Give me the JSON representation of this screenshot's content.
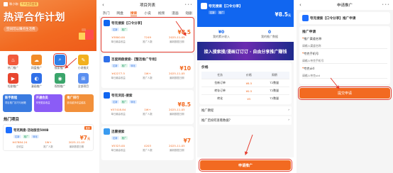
{
  "p1": {
    "brand": "咪小咖",
    "badge": "个人主页会员",
    "title": "热评合作计划",
    "subtitle": "空间可以赚点生活费",
    "icons": [
      {
        "label": "热门推广",
        "color": "#f25a3c",
        "g": "♨"
      },
      {
        "label": "网盘推广",
        "color": "#f28c28",
        "g": "☁"
      },
      {
        "label": "搜索推广",
        "color": "#2f7fe8",
        "g": "⌕"
      },
      {
        "label": "小说推文",
        "color": "#f2b01e",
        "g": "✎"
      },
      {
        "label": "短剧推广",
        "color": "#e8452f",
        "g": "▶"
      },
      {
        "label": "漫画推广",
        "color": "#2f6fe8",
        "g": "◐"
      },
      {
        "label": "视频推广",
        "color": "#3aa56b",
        "g": "◉"
      },
      {
        "label": "全部项目",
        "color": "#5a8ff0",
        "g": "⊞"
      }
    ],
    "cards": [
      {
        "t": "新手教程",
        "s": "项目推广技巧与秘籍",
        "c": "#3a7be0"
      },
      {
        "t": "开通会员",
        "s": "享受更高收益",
        "c": "#8b5cf6"
      },
      {
        "t": "推广排行",
        "s": "邀请越多收益越高",
        "c": "#f2903a"
      }
    ],
    "section": "热门项目",
    "hot": {
      "name": "夸克网盘-活动版佳500B",
      "tags": [
        "拉新",
        "推广",
        "转化"
      ],
      "price": "7",
      "unit": "元",
      "badge": "推荐",
      "stats": [
        {
          "v": "¥47884.24",
          "l": "总收益"
        },
        {
          "v": "1W+",
          "l": "推广人数"
        },
        {
          "v": "2025-11-05",
          "l": "最新数据日期"
        }
      ]
    }
  },
  "p2": {
    "title": "项目列表",
    "tabs": [
      "热门",
      "网盘",
      "搜索",
      "小说",
      "视频",
      "漫画",
      "短剧"
    ],
    "active": 2,
    "items": [
      {
        "name": "夸克搜索【口令分享】",
        "tags": [
          "拉新",
          "推广"
        ],
        "price": "8.5",
        "c": "#1166f0",
        "stats": [
          "¥3800.00",
          "7249",
          "2025-11-05"
        ],
        "labels": [
          "单日最高收益",
          "推广人数",
          "最新数据日期"
        ]
      },
      {
        "name": "百度网盘搜索-【整活推广专场】",
        "tags": [
          "拉新",
          "推广",
          "转化"
        ],
        "price": "10",
        "c": "#2f6fe8",
        "stats": [
          "¥42277.5",
          "1W+",
          "2025-11-05"
        ],
        "labels": [
          "单日最高收益",
          "推广人数",
          "最新数据日期"
        ]
      },
      {
        "name": "夸克浏览-搜索",
        "tags": [
          "拉新",
          "推广",
          "转化"
        ],
        "price": "8.5",
        "c": "#1166f0",
        "stats": [
          "¥57418.84",
          "1W+",
          "2025-11-05"
        ],
        "labels": [
          "单日最高收益",
          "推广人数",
          "最新数据日期"
        ]
      },
      {
        "name": "迅雷搜索",
        "tags": [
          "拉新",
          "推广"
        ],
        "price": "7",
        "c": "#3a9bf0",
        "stats": [
          "¥5323.00",
          "4203",
          "2025-11-05"
        ],
        "labels": [
          "单日最高收益",
          "推广人数",
          "最新数据日期"
        ]
      }
    ]
  },
  "p3": {
    "name": "夸克搜索【口令分享】",
    "tags": [
      "拉新",
      "推广"
    ],
    "price": "8.5",
    "unit": "元",
    "s1": "¥0",
    "s1l": "我的累计收入",
    "s2": "0",
    "s2l": "我的推广数据",
    "banner": "接入搜索搜/漫画订订订 · 自由分享推广赚钱",
    "tblTitle": "价格",
    "tbl": {
      "head": [
        "任务",
        "价格",
        "周期"
      ],
      "rows": [
        [
          "拉新订单",
          "¥8.5",
          "T2数量"
        ],
        [
          "转存订单",
          "¥0.5",
          "T2数量"
        ],
        [
          "转化",
          "¥5",
          "T2数量"
        ]
      ]
    },
    "row1": "推广教程",
    "row2": "推广后如何查看数据？",
    "btn": "申请推广"
  },
  "p4": {
    "title": "申请推广",
    "proj": "夸克搜索【口令分享】推广申请",
    "sec": "推广申请",
    "fields": [
      {
        "l": "推广渠道名称",
        "ph": "请输入渠道名称"
      },
      {
        "l": "夸克手机号",
        "ph": "请输入夸克手机号"
      },
      {
        "l": "夸克uid",
        "ph": "请输入夸克uid"
      }
    ],
    "submit": "提交申请"
  }
}
